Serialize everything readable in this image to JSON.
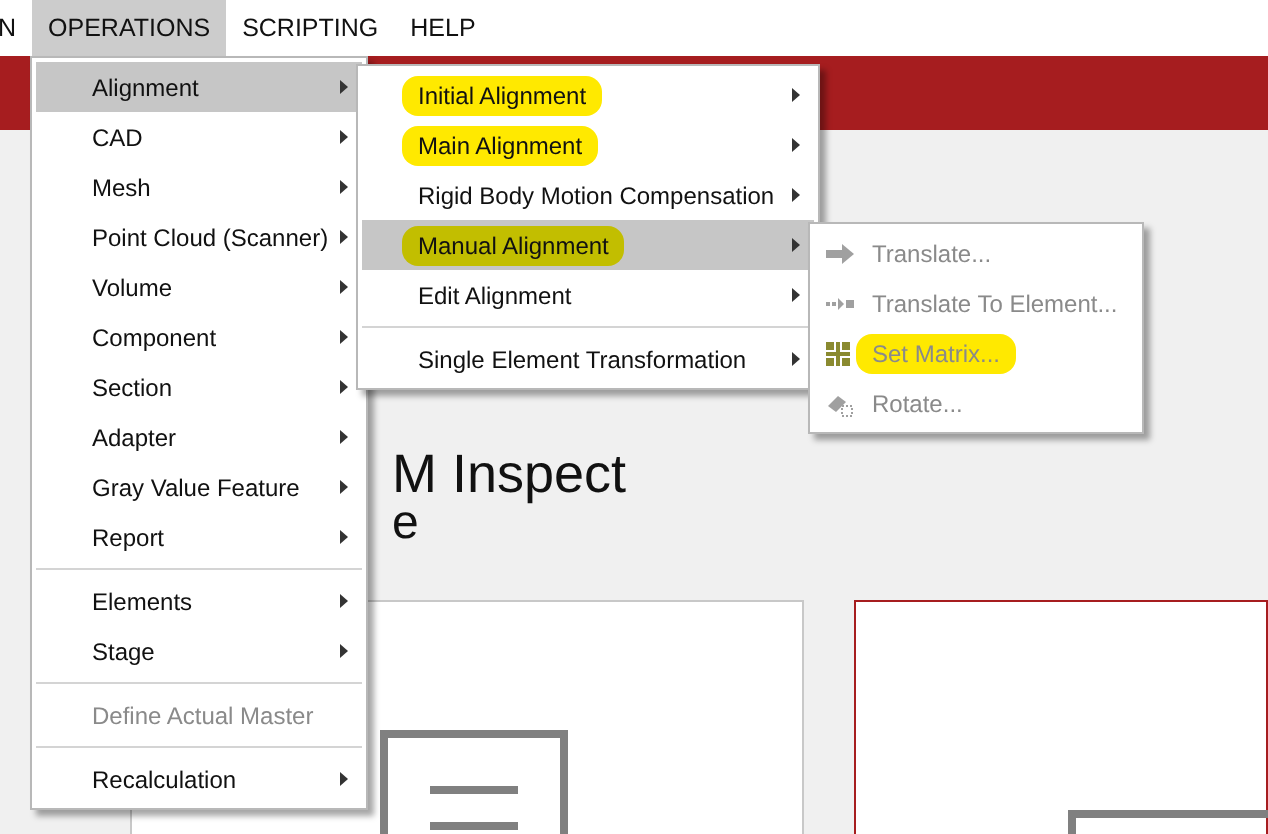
{
  "menubar": [
    {
      "label": "N",
      "selected": false
    },
    {
      "label": "OPERATIONS",
      "selected": true
    },
    {
      "label": "SCRIPTING",
      "selected": false
    },
    {
      "label": "HELP",
      "selected": false
    }
  ],
  "background": {
    "title": "M Inspect",
    "subtitle": "e"
  },
  "operations_menu": [
    {
      "kind": "item",
      "label": "Alignment",
      "selected": true,
      "disabled": false,
      "highlighted": false,
      "submenu": true
    },
    {
      "kind": "item",
      "label": "CAD",
      "selected": false,
      "disabled": false,
      "highlighted": false,
      "submenu": true
    },
    {
      "kind": "item",
      "label": "Mesh",
      "selected": false,
      "disabled": false,
      "highlighted": false,
      "submenu": true
    },
    {
      "kind": "item",
      "label": "Point Cloud (Scanner)",
      "selected": false,
      "disabled": false,
      "highlighted": false,
      "submenu": true
    },
    {
      "kind": "item",
      "label": "Volume",
      "selected": false,
      "disabled": false,
      "highlighted": false,
      "submenu": true
    },
    {
      "kind": "item",
      "label": "Component",
      "selected": false,
      "disabled": false,
      "highlighted": false,
      "submenu": true
    },
    {
      "kind": "item",
      "label": "Section",
      "selected": false,
      "disabled": false,
      "highlighted": false,
      "submenu": true
    },
    {
      "kind": "item",
      "label": "Adapter",
      "selected": false,
      "disabled": false,
      "highlighted": false,
      "submenu": true
    },
    {
      "kind": "item",
      "label": "Gray Value Feature",
      "selected": false,
      "disabled": false,
      "highlighted": false,
      "submenu": true
    },
    {
      "kind": "item",
      "label": "Report",
      "selected": false,
      "disabled": false,
      "highlighted": false,
      "submenu": true
    },
    {
      "kind": "separator"
    },
    {
      "kind": "item",
      "label": "Elements",
      "selected": false,
      "disabled": false,
      "highlighted": false,
      "submenu": true
    },
    {
      "kind": "item",
      "label": "Stage",
      "selected": false,
      "disabled": false,
      "highlighted": false,
      "submenu": true
    },
    {
      "kind": "separator"
    },
    {
      "kind": "item",
      "label": "Define Actual Master",
      "selected": false,
      "disabled": true,
      "highlighted": false,
      "submenu": false
    },
    {
      "kind": "separator"
    },
    {
      "kind": "item",
      "label": "Recalculation",
      "selected": false,
      "disabled": false,
      "highlighted": false,
      "submenu": true
    }
  ],
  "alignment_menu": [
    {
      "kind": "item",
      "label": "Initial Alignment",
      "selected": false,
      "disabled": false,
      "highlighted": true,
      "submenu": true
    },
    {
      "kind": "item",
      "label": "Main Alignment",
      "selected": false,
      "disabled": false,
      "highlighted": true,
      "submenu": true
    },
    {
      "kind": "item",
      "label": "Rigid Body Motion Compensation",
      "selected": false,
      "disabled": false,
      "highlighted": false,
      "submenu": true
    },
    {
      "kind": "item",
      "label": "Manual Alignment",
      "selected": true,
      "disabled": false,
      "highlighted": true,
      "submenu": true
    },
    {
      "kind": "item",
      "label": "Edit Alignment",
      "selected": false,
      "disabled": false,
      "highlighted": false,
      "submenu": true
    },
    {
      "kind": "separator"
    },
    {
      "kind": "item",
      "label": "Single Element Transformation",
      "selected": false,
      "disabled": false,
      "highlighted": false,
      "submenu": true
    }
  ],
  "manual_alignment_menu": [
    {
      "kind": "item",
      "label": "Translate...",
      "selected": false,
      "disabled": true,
      "highlighted": false,
      "submenu": false
    },
    {
      "kind": "item",
      "label": "Translate To Element...",
      "selected": false,
      "disabled": true,
      "highlighted": false,
      "submenu": false
    },
    {
      "kind": "item",
      "label": "Set Matrix...",
      "selected": false,
      "disabled": true,
      "highlighted": true,
      "submenu": false
    },
    {
      "kind": "item",
      "label": "Rotate...",
      "selected": false,
      "disabled": true,
      "highlighted": false,
      "submenu": false
    }
  ]
}
